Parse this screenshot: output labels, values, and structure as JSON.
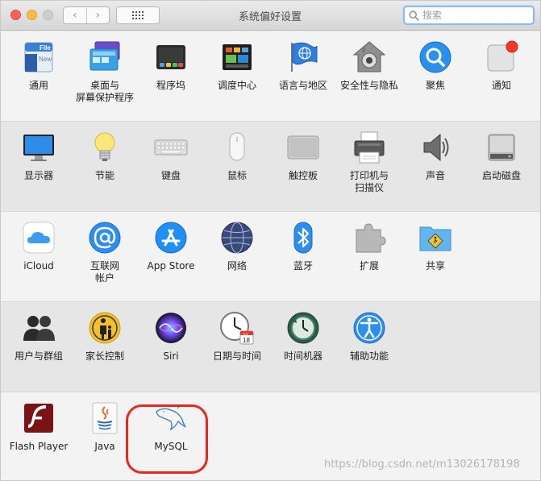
{
  "window": {
    "title": "系统偏好设置"
  },
  "toolbar": {
    "back": "‹",
    "forward": "›"
  },
  "search": {
    "placeholder": "搜索"
  },
  "rows": [
    [
      "通用",
      "桌面与\n屏幕保护程序",
      "程序坞",
      "调度中心",
      "语言与地区",
      "安全性与隐私",
      "聚焦",
      "通知"
    ],
    [
      "显示器",
      "节能",
      "键盘",
      "鼠标",
      "触控板",
      "打印机与\n扫描仪",
      "声音",
      "启动磁盘"
    ],
    [
      "iCloud",
      "互联网\n帐户",
      "App Store",
      "网络",
      "蓝牙",
      "扩展",
      "共享"
    ],
    [
      "用户与群组",
      "家长控制",
      "Siri",
      "日期与时间",
      "时间机器",
      "辅助功能"
    ],
    [
      "Flash Player",
      "Java",
      "MySQL"
    ]
  ],
  "icon_text": {
    "general_file": "File",
    "general_new": "New",
    "calendar_month": "JUL",
    "calendar_day": "18"
  },
  "watermark": "https://blog.csdn.net/m13026178198",
  "colors": {
    "accent": "#2f7ff4",
    "highlight": "#e8281c"
  }
}
